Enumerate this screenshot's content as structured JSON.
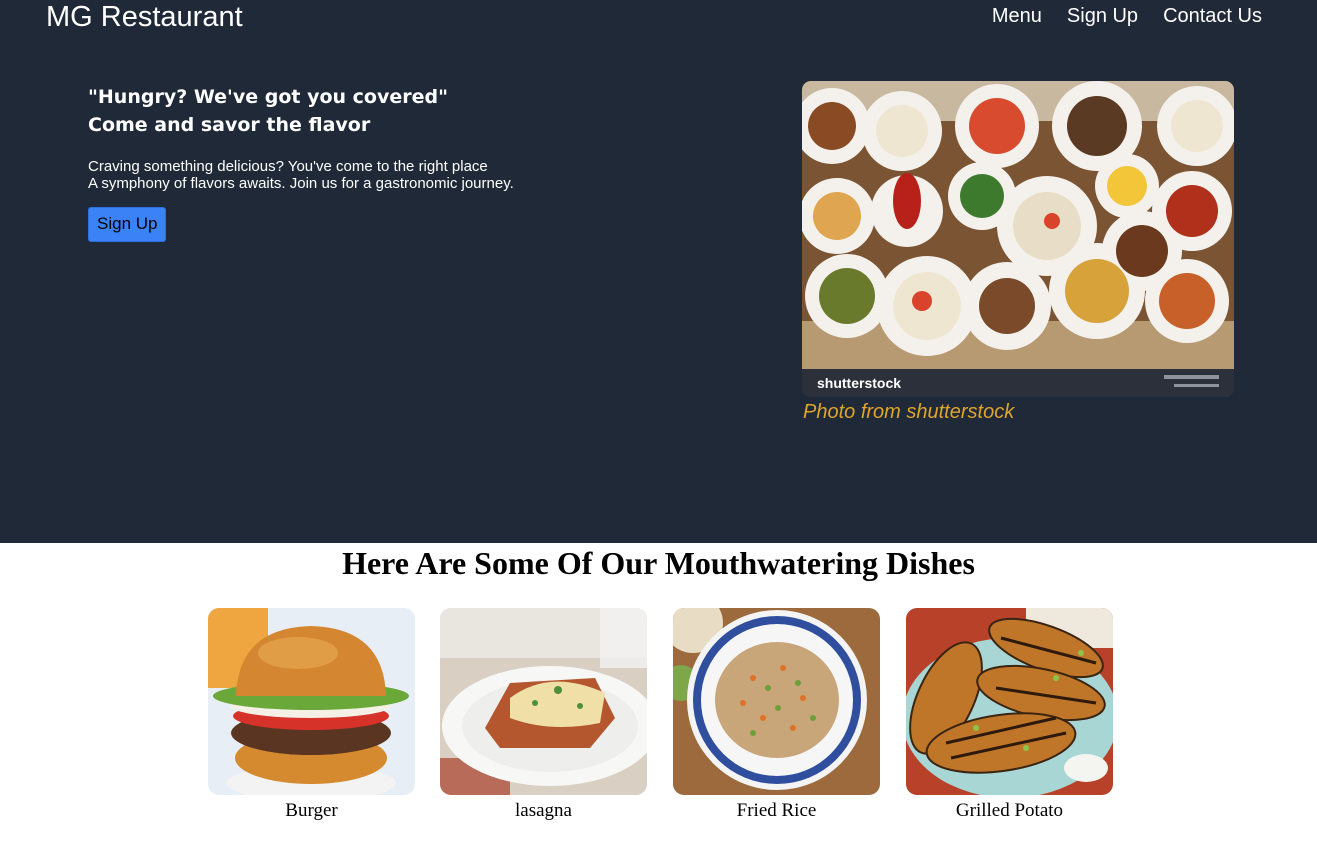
{
  "header": {
    "brand": "MG Restaurant",
    "nav": [
      "Menu",
      "Sign Up",
      "Contact Us"
    ]
  },
  "hero": {
    "tagline_line1": "\"Hungry? We've got you covered\"",
    "tagline_line2": "Come and savor the flavor",
    "desc_line1": "Craving something delicious? You've come to the right place",
    "desc_line2": "A symphony of flavors awaits. Join us for a gastronomic journey.",
    "cta_label": "Sign Up",
    "photo_watermark": "shutterstock",
    "photo_credit": "Photo from shutterstock"
  },
  "dishes": {
    "title": "Here Are Some Of Our Mouthwatering Dishes",
    "items": [
      {
        "name": "Burger"
      },
      {
        "name": "lasagna"
      },
      {
        "name": "Fried Rice"
      },
      {
        "name": "Grilled Potato"
      }
    ]
  },
  "colors": {
    "hero_bg": "#1f2937",
    "cta_bg": "#3b82f6",
    "credit_text": "#e0a52a"
  }
}
